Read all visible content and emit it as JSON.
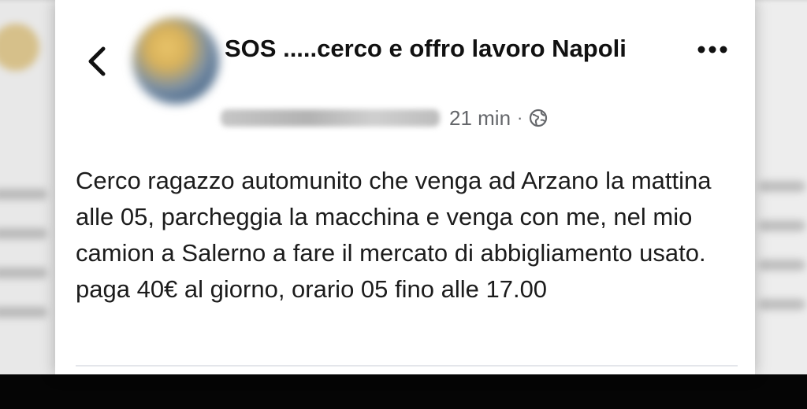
{
  "post": {
    "group_name": "SOS .....cerco e offro lavoro Napoli",
    "time": "21 min",
    "separator": "·",
    "text": "Cerco ragazzo automunito che venga ad Arzano la mattina alle 05, parcheggia la macchina e venga con me, nel mio camion a Salerno  a fare il mercato di abbigliamento usato. paga 40€ al giorno, orario 05 fino alle 17.00"
  },
  "icons": {
    "back": "chevron-left-icon",
    "more": "more-horizontal-icon",
    "privacy": "globe-icon"
  }
}
